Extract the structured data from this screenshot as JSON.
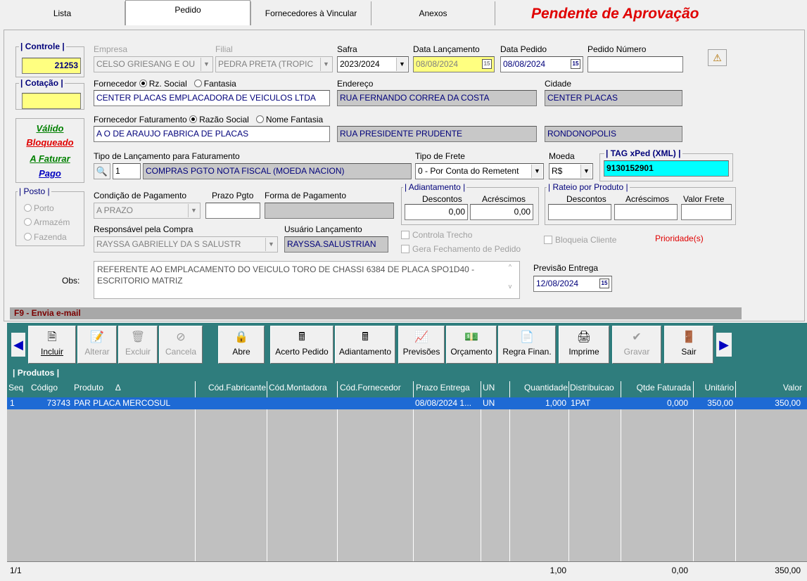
{
  "tabs": [
    "Lista",
    "Pedido",
    "Fornecedores à Vincular",
    "Anexos"
  ],
  "status_title": "Pendente de Aprovação",
  "controle": {
    "label": "| Controle |",
    "value": "21253"
  },
  "cotacao": {
    "label": "| Cotação |",
    "value": ""
  },
  "empresa": {
    "label": "Empresa",
    "value": "CELSO GRIESANG E OU"
  },
  "filial": {
    "label": "Filial",
    "value": "PEDRA PRETA (TROPIC"
  },
  "safra": {
    "label": "Safra",
    "value": "2023/2024"
  },
  "data_lancamento": {
    "label": "Data Lançamento",
    "value": "08/08/2024"
  },
  "data_pedido": {
    "label": "Data Pedido",
    "value": "08/08/2024"
  },
  "pedido_numero": {
    "label": "Pedido Número",
    "value": ""
  },
  "fornecedor": {
    "label": "Fornecedor",
    "opt1": "Rz. Social",
    "opt2": "Fantasia",
    "value": "CENTER PLACAS EMPLACADORA DE VEICULOS LTDA",
    "endereco_label": "Endereço",
    "endereco": "RUA FERNANDO CORREA DA COSTA",
    "cidade_label": "Cidade",
    "cidade": "CENTER PLACAS"
  },
  "fornecedor_faturamento": {
    "label": "Fornecedor Faturamento",
    "opt1": "Razão Social",
    "opt2": "Nome Fantasia",
    "value": "A O DE ARAUJO FABRICA DE PLACAS",
    "endereco": "RUA PRESIDENTE PRUDENTE",
    "cidade": "RONDONOPOLIS"
  },
  "situacao": [
    "Válido",
    "Bloqueado",
    "A Faturar",
    "Pago"
  ],
  "tipo_lancamento": {
    "label": "Tipo de Lançamento para Faturamento",
    "code": "1",
    "value": "COMPRAS PGTO NOTA FISCAL (MOEDA NACION)"
  },
  "tipo_frete": {
    "label": "Tipo de Frete",
    "value": "0 - Por Conta do Remetent"
  },
  "moeda": {
    "label": "Moeda",
    "value": "R$"
  },
  "tag_xped": {
    "label": "| TAG xPed (XML) |",
    "value": "9130152901"
  },
  "posto": {
    "label": "| Posto |",
    "options": [
      "Porto",
      "Armazém",
      "Fazenda"
    ]
  },
  "condicao_pagamento": {
    "label": "Condição de Pagamento",
    "value": "A PRAZO"
  },
  "prazo_pgto": {
    "label": "Prazo Pgto",
    "value": ""
  },
  "forma_pagamento": {
    "label": "Forma de Pagamento",
    "value": ""
  },
  "adiantamento": {
    "label": "| Adiantamento |",
    "descontos_label": "Descontos",
    "acrescimos_label": "Acréscimos",
    "descontos": "0,00",
    "acrescimos": "0,00"
  },
  "rateio": {
    "label": "| Rateio por Produto |",
    "descontos_label": "Descontos",
    "acrescimos_label": "Acréscimos",
    "frete_label": "Valor Frete"
  },
  "responsavel": {
    "label": "Responsável pela Compra",
    "value": "RAYSSA GABRIELLY DA S SALUSTR"
  },
  "usuario_lancamento": {
    "label": "Usuário Lançamento",
    "value": "RAYSSA.SALUSTRIAN"
  },
  "checks": {
    "controla_trecho": "Controla Trecho",
    "gera_fechamento": "Gera Fechamento de Pedido",
    "bloqueia_cliente": "Bloqueia Cliente"
  },
  "prioridade": "Prioridade(s)",
  "obs": {
    "label": "Obs:",
    "value": "REFERENTE AO EMPLACAMENTO DO VEICULO TORO DE CHASSI 6384 DE PLACA SPO1D40 - ESCRITORIO MATRIZ"
  },
  "previsao_entrega": {
    "label": "Previsão Entrega",
    "value": "12/08/2024"
  },
  "f9": "F9 - Envia e-mail",
  "toolbar": [
    "Incluir",
    "Alterar",
    "Excluir",
    "Cancela",
    "Abre",
    "Acerto Pedido",
    "Adiantamento",
    "Previsões",
    "Orçamento",
    "Regra Finan.",
    "Imprime",
    "Gravar",
    "Sair"
  ],
  "produtos": {
    "title": "| Produtos |",
    "headers": [
      "Seq",
      "Código",
      "Produto",
      "Cód.Fabricante",
      "Cód.Montadora",
      "Cód.Fornecedor",
      "Prazo Entrega",
      "UN",
      "Quantidade",
      "Distribuicao",
      "Qtde Faturada",
      "Unitário",
      "Valor"
    ],
    "rows": [
      [
        "1",
        "73743",
        "PAR PLACA MERCOSUL",
        "",
        "",
        "",
        "08/08/2024 1...",
        "UN",
        "1,000",
        "1PAT",
        "0,000",
        "350,00",
        "350,00"
      ]
    ],
    "footer": {
      "count": "1/1",
      "quantidade": "1,00",
      "faturada": "0,00",
      "valor": "350,00"
    }
  }
}
